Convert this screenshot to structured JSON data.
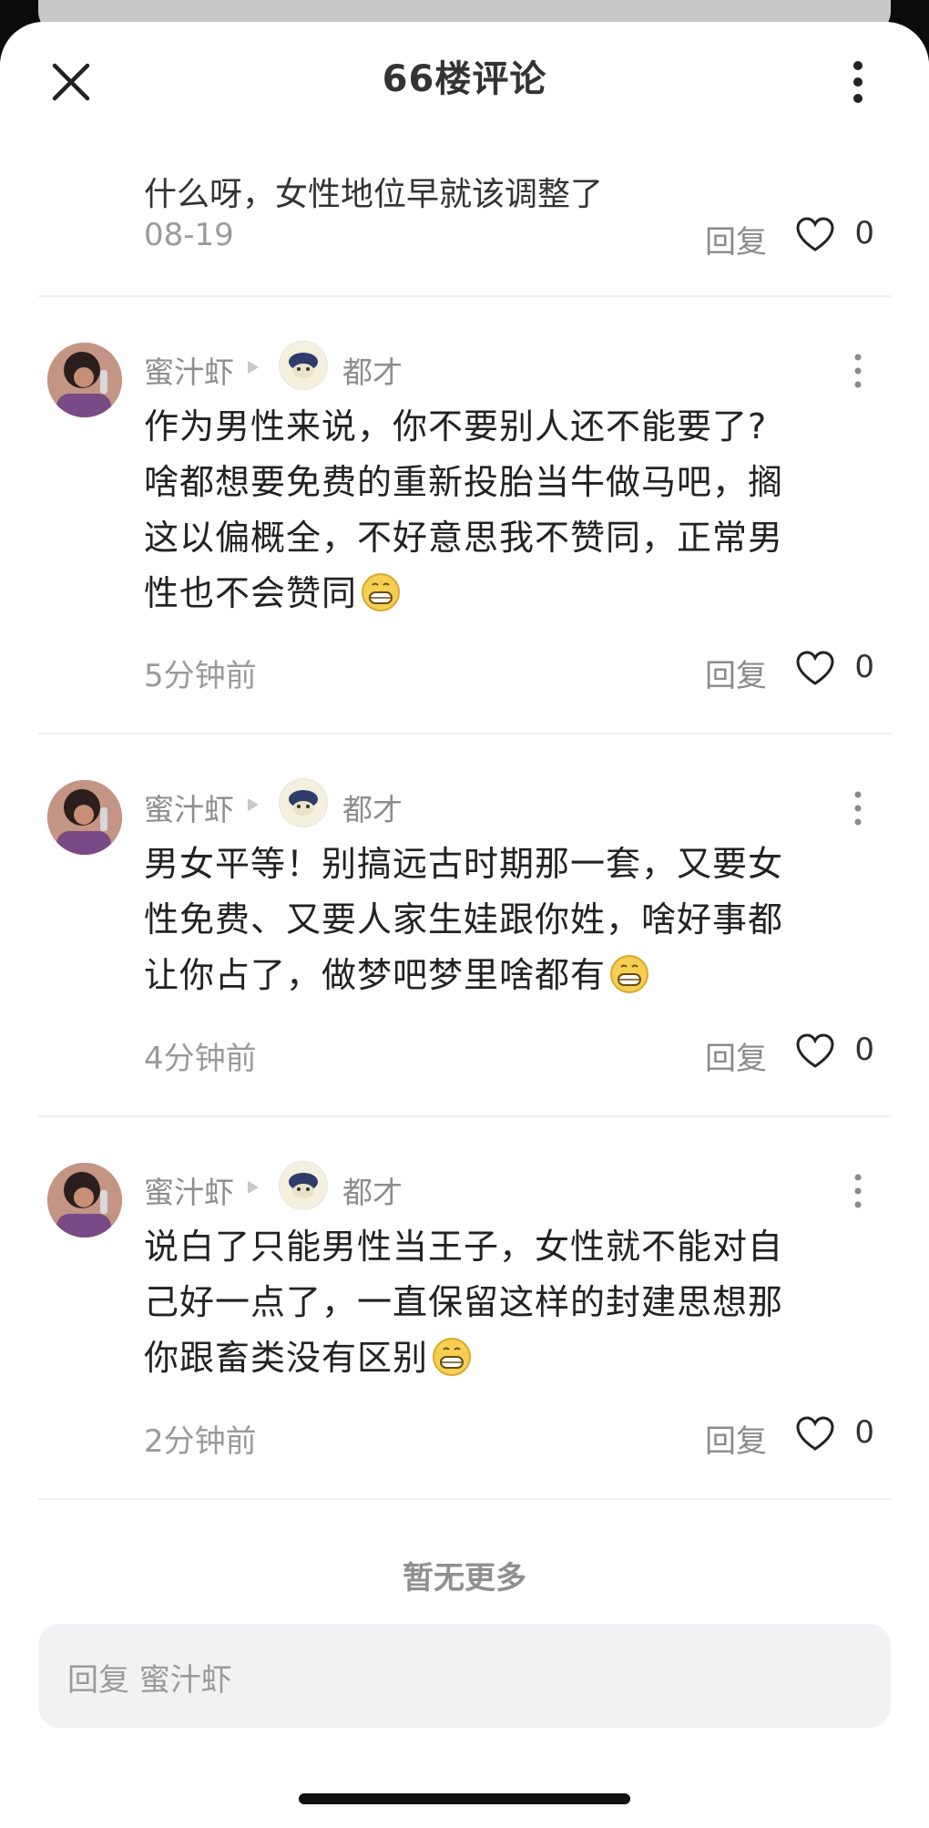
{
  "header": {
    "title": "66楼评论"
  },
  "previous_comment": {
    "partial_text": "什么呀，女性地位早就该调整了",
    "time": "08-19",
    "reply_label": "回复",
    "likes": "0"
  },
  "comments": [
    {
      "username": "蜜汁虾",
      "reply_to": "都才",
      "lines": [
        "作为男性来说，你不要别人还不能要了?",
        "啥都想要免费的重新投胎当牛做马吧，搁",
        "这以偏概全，不好意思我不赞同，正常男",
        "性也不会赞同"
      ],
      "time": "5分钟前",
      "reply_label": "回复",
      "likes": "0"
    },
    {
      "username": "蜜汁虾",
      "reply_to": "都才",
      "lines": [
        "男女平等！别搞远古时期那一套，又要女",
        "性免费、又要人家生娃跟你姓，啥好事都",
        "让你占了，做梦吧梦里啥都有"
      ],
      "time": "4分钟前",
      "reply_label": "回复",
      "likes": "0"
    },
    {
      "username": "蜜汁虾",
      "reply_to": "都才",
      "lines": [
        "说白了只能男性当王子，女性就不能对自",
        "己好一点了，一直保留这样的封建思想那",
        "你跟畜类没有区别"
      ],
      "time": "2分钟前",
      "reply_label": "回复",
      "likes": "0"
    }
  ],
  "footer": {
    "no_more": "暂无更多",
    "reply_placeholder": "回复 蜜汁虾"
  },
  "icons": {
    "close": "close-icon",
    "more": "more-vertical-icon",
    "like": "heart-outline-icon",
    "emoji": "grinning-emoji-icon"
  }
}
